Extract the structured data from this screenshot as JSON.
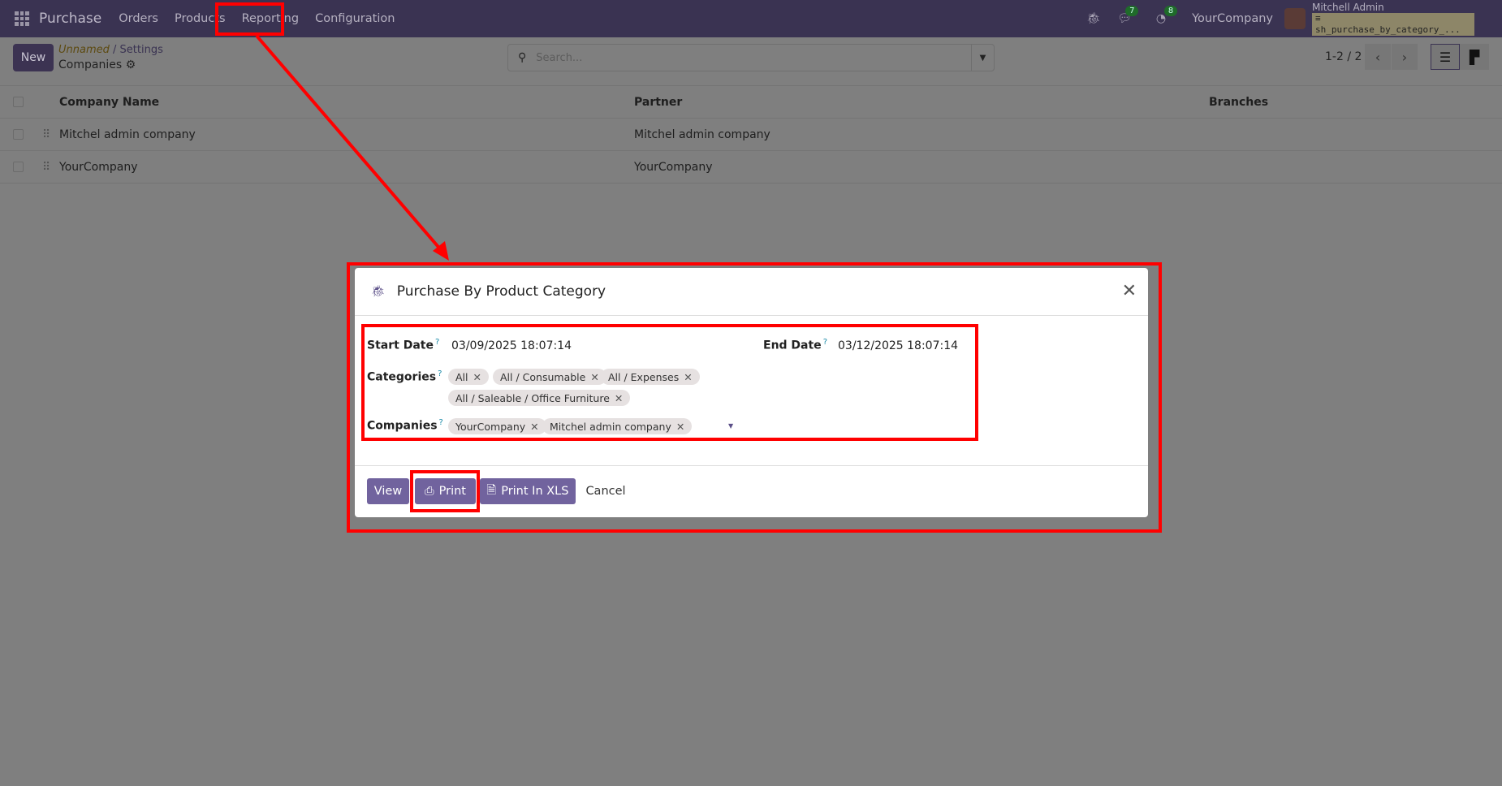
{
  "navbar": {
    "app": "Purchase",
    "menu": [
      "Orders",
      "Products",
      "Reporting",
      "Configuration"
    ],
    "messages_count": "7",
    "activities_count": "8",
    "company": "YourCompany",
    "user": "Mitchell Admin",
    "database": "sh_purchase_by_category_..."
  },
  "control_panel": {
    "new_label": "New",
    "breadcrumb_parent": "Unnamed",
    "breadcrumb_sep": "/",
    "breadcrumb_settings": "Settings",
    "title": "Companies",
    "search_placeholder": "Search...",
    "pager": "1-2 / 2"
  },
  "table": {
    "headers": [
      "Company Name",
      "Partner",
      "Branches"
    ],
    "rows": [
      {
        "name": "Mitchel admin company",
        "partner": "Mitchel admin company"
      },
      {
        "name": "YourCompany",
        "partner": "YourCompany"
      }
    ]
  },
  "dialog": {
    "title": "Purchase By Product Category",
    "help": "?",
    "start_label": "Start Date",
    "start_value": "03/09/2025 18:07:14",
    "end_label": "End Date",
    "end_value": "03/12/2025 18:07:14",
    "categories_label": "Categories",
    "categories": [
      "All",
      "All / Consumable",
      "All / Expenses",
      "All / Saleable / Office Furniture"
    ],
    "companies_label": "Companies",
    "companies": [
      "YourCompany",
      "Mitchel admin company"
    ],
    "view": "View",
    "print": "Print",
    "print_xls": "Print In XLS",
    "cancel": "Cancel"
  },
  "colors": {
    "accent": "#71639e",
    "annotation": "#ff0000"
  }
}
